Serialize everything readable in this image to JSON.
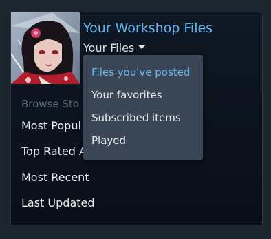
{
  "header": {
    "title": "Your Workshop Files",
    "dropdown_label": "Your Files"
  },
  "browse": {
    "section_label": "Browse Sto",
    "items": [
      {
        "label": "Most Popul"
      },
      {
        "label": "Top Rated A"
      },
      {
        "label": "Most Recent"
      },
      {
        "label": "Last Updated"
      }
    ]
  },
  "dropdown": {
    "items": [
      {
        "label": "Files you've posted",
        "active": true
      },
      {
        "label": "Your favorites",
        "active": false
      },
      {
        "label": "Subscribed items",
        "active": false
      },
      {
        "label": "Played",
        "active": false
      }
    ]
  },
  "colors": {
    "accent": "#66b8f2",
    "dropdown_bg": "#3a4656",
    "panel_bg": "#0f1824"
  }
}
